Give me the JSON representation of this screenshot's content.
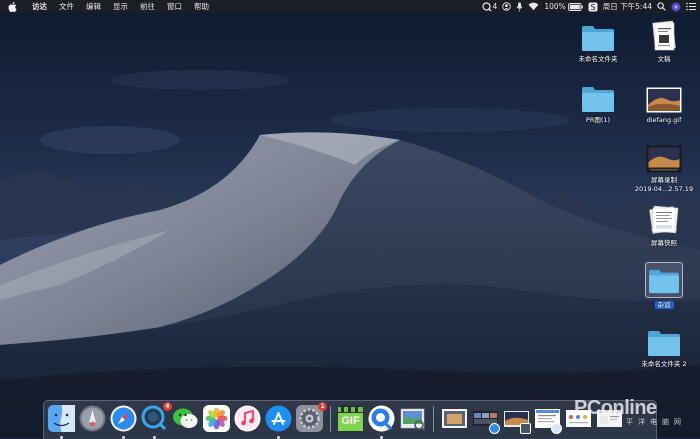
{
  "menubar": {
    "app_name": "访达",
    "menus": [
      "文件",
      "编辑",
      "显示",
      "前往",
      "窗口",
      "帮助"
    ],
    "status": {
      "notification_count": "4",
      "battery": "100%",
      "clock": "周日 下午5:44"
    },
    "icons": [
      "apple-logo-icon",
      "chat-bubble-icon",
      "person-icon",
      "microphone-icon",
      "wifi-icon",
      "battery-icon",
      "s-app-icon",
      "search-icon",
      "siri-icon",
      "list-icon"
    ]
  },
  "desktop": {
    "items": [
      {
        "label": "未命名文件夹",
        "icon": "folder-icon"
      },
      {
        "label": "文稿",
        "icon": "document-icon"
      },
      {
        "label": "PR图(1)",
        "icon": "folder-icon"
      },
      {
        "label": "diefang.gif",
        "icon": "image-file-icon"
      },
      {
        "label_line1": "屏幕录制",
        "label_line2": "2019-04...2.57.19",
        "icon": "video-file-icon"
      },
      {
        "label": "屏幕快照",
        "icon": "screenshot-stack-icon"
      },
      {
        "label": "杂谈",
        "icon": "folder-icon",
        "selected": true
      },
      {
        "label": "未命名文件夹 2",
        "icon": "folder-icon"
      }
    ]
  },
  "dock": {
    "apps": [
      {
        "name": "finder-icon",
        "running": true
      },
      {
        "name": "launchpad-icon",
        "running": false
      },
      {
        "name": "safari-icon",
        "running": true
      },
      {
        "name": "qq-icon",
        "running": true,
        "badge": "4"
      },
      {
        "name": "wechat-icon",
        "running": false
      },
      {
        "name": "photos-icon",
        "running": false
      },
      {
        "name": "music-icon",
        "running": false
      },
      {
        "name": "app-store-icon",
        "running": true
      },
      {
        "name": "system-preferences-icon",
        "running": false,
        "badge": "1"
      },
      {
        "name": "gif-maker-icon",
        "running": false,
        "text": "GIF"
      },
      {
        "name": "quark-browser-icon",
        "running": true
      },
      {
        "name": "preview-icon",
        "running": false
      },
      {
        "name": "photo-thumbnail-icon",
        "running": false
      },
      {
        "name": "windows-minimized-icon",
        "running": false
      },
      {
        "name": "screen-minimized-icon",
        "running": false
      },
      {
        "name": "document-minimized-icon",
        "running": false
      },
      {
        "name": "page-minimized-icon",
        "running": false
      },
      {
        "name": "browser-minimized-icon",
        "running": false
      }
    ]
  },
  "watermark": {
    "main": "PConline",
    "sub": "太平洋电脑网"
  },
  "colors": {
    "sky_top": "#101a2e",
    "sky_mid": "#2a3a5c",
    "dune_light": "#8d93a3",
    "dune_shadow": "#3c465e",
    "menubar": "#1c1e24",
    "folder": "#6cc1ea",
    "selection": "#2463d9"
  }
}
